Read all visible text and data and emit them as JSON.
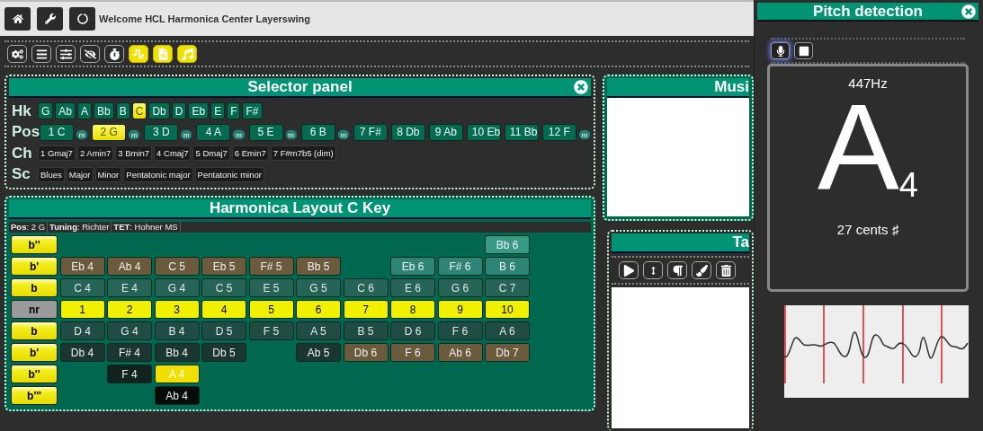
{
  "header": {
    "title": "Welcome HCL Harmonica Center Layerswing"
  },
  "toolbar": [
    {
      "active": false
    },
    {
      "active": false
    },
    {
      "active": false
    },
    {
      "active": false
    },
    {
      "active": false
    },
    {
      "active": true
    },
    {
      "active": true
    },
    {
      "active": true
    }
  ],
  "selector_panel": {
    "title": "Selector panel",
    "harmonica_keys": {
      "label": "Hk",
      "items": [
        {
          "label": "G",
          "selected": false
        },
        {
          "label": "Ab",
          "selected": false
        },
        {
          "label": "A",
          "selected": false
        },
        {
          "label": "Bb",
          "selected": false
        },
        {
          "label": "B",
          "selected": false
        },
        {
          "label": "C",
          "selected": true
        },
        {
          "label": "Db",
          "selected": false
        },
        {
          "label": "D",
          "selected": false
        },
        {
          "label": "Eb",
          "selected": false
        },
        {
          "label": "E",
          "selected": false
        },
        {
          "label": "F",
          "selected": false
        },
        {
          "label": "F#",
          "selected": false
        }
      ]
    },
    "positions": {
      "label": "Pos",
      "items": [
        {
          "label": "1 C",
          "selected": false,
          "minor": "m"
        },
        {
          "label": "2 G",
          "selected": true,
          "minor": "m"
        },
        {
          "label": "3 D",
          "selected": false,
          "minor": "m"
        },
        {
          "label": "4 A",
          "selected": false,
          "minor": "m"
        },
        {
          "label": "5 E",
          "selected": false,
          "minor": "m"
        },
        {
          "label": "6 B",
          "selected": false,
          "minor": "m"
        },
        {
          "label": "7 F#",
          "selected": false
        },
        {
          "label": "8 Db",
          "selected": false
        },
        {
          "label": "9 Ab",
          "selected": false
        },
        {
          "label": "10 Eb",
          "selected": false
        },
        {
          "label": "11 Bb",
          "selected": false
        },
        {
          "label": "12 F",
          "selected": false,
          "minor": "m"
        }
      ]
    },
    "chords": {
      "label": "Ch",
      "items": [
        "1 Gmaj7",
        "2 Amin7",
        "3 Bmin7",
        "4 Cmaj7",
        "5 Dmaj7",
        "6 Emin7",
        "7 F#m7b5 (dim)"
      ]
    },
    "scales": {
      "label": "Sc",
      "items": [
        "Blues",
        "Major",
        "Minor",
        "Pentatonic major",
        "Pentatonic minor"
      ]
    }
  },
  "layout_panel": {
    "title": "Harmonica Layout C Key",
    "info": [
      "**Pos**: 2 G",
      "**Tuning**: Richter",
      "**TET**: Hohner MS"
    ],
    "rows": [
      {
        "label": "b''",
        "kind": "bend",
        "cells": [
          {
            "kind": "empty"
          },
          {
            "kind": "empty"
          },
          {
            "kind": "empty"
          },
          {
            "kind": "empty"
          },
          {
            "kind": "empty"
          },
          {
            "kind": "empty"
          },
          {
            "kind": "empty"
          },
          {
            "kind": "empty"
          },
          {
            "kind": "empty"
          },
          {
            "note": "Bb 6",
            "kind": "blow_bend2"
          }
        ]
      },
      {
        "label": "b'",
        "kind": "bend",
        "cells": [
          {
            "note": "Eb 4",
            "kind": "overblow"
          },
          {
            "note": "Ab 4",
            "kind": "overblow"
          },
          {
            "note": "C 5",
            "kind": "overblow"
          },
          {
            "note": "Eb 5",
            "kind": "overblow"
          },
          {
            "note": "F# 5",
            "kind": "overblow"
          },
          {
            "note": "Bb 5",
            "kind": "overblow"
          },
          {
            "kind": "empty"
          },
          {
            "note": "Eb 6",
            "kind": "blow_bend"
          },
          {
            "note": "F# 6",
            "kind": "blow_bend"
          },
          {
            "note": "B 6",
            "kind": "blow_bend"
          }
        ]
      },
      {
        "label": "b",
        "kind": "bend",
        "cells": [
          {
            "note": "C 4",
            "kind": "blow"
          },
          {
            "note": "E 4",
            "kind": "blow"
          },
          {
            "note": "G 4",
            "kind": "blow"
          },
          {
            "note": "C 5",
            "kind": "blow"
          },
          {
            "note": "E 5",
            "kind": "blow"
          },
          {
            "note": "G 5",
            "kind": "blow"
          },
          {
            "note": "C 6",
            "kind": "blow"
          },
          {
            "note": "E 6",
            "kind": "blow"
          },
          {
            "note": "G 6",
            "kind": "blow"
          },
          {
            "note": "C 7",
            "kind": "blow"
          }
        ]
      },
      {
        "label": "nr",
        "kind": "hole_number",
        "cells": [
          {
            "note": "1",
            "kind": "hole"
          },
          {
            "note": "2",
            "kind": "hole"
          },
          {
            "note": "3",
            "kind": "hole"
          },
          {
            "note": "4",
            "kind": "hole"
          },
          {
            "note": "5",
            "kind": "hole"
          },
          {
            "note": "6",
            "kind": "hole"
          },
          {
            "note": "7",
            "kind": "hole"
          },
          {
            "note": "8",
            "kind": "hole"
          },
          {
            "note": "9",
            "kind": "hole"
          },
          {
            "note": "10",
            "kind": "hole"
          }
        ]
      },
      {
        "label": "b",
        "kind": "bend",
        "cells": [
          {
            "note": "D 4",
            "kind": "draw"
          },
          {
            "note": "G 4",
            "kind": "draw"
          },
          {
            "note": "B 4",
            "kind": "draw"
          },
          {
            "note": "D 5",
            "kind": "draw"
          },
          {
            "note": "F 5",
            "kind": "draw"
          },
          {
            "note": "A 5",
            "kind": "draw"
          },
          {
            "note": "B 5",
            "kind": "draw"
          },
          {
            "note": "D 6",
            "kind": "draw"
          },
          {
            "note": "F 6",
            "kind": "draw"
          },
          {
            "note": "A 6",
            "kind": "draw"
          }
        ]
      },
      {
        "label": "b'",
        "kind": "bend",
        "cells": [
          {
            "note": "Db 4",
            "kind": "draw_bend"
          },
          {
            "note": "F# 4",
            "kind": "draw_bend"
          },
          {
            "note": "Bb 4",
            "kind": "draw_bend"
          },
          {
            "note": "Db 5",
            "kind": "draw_bend"
          },
          {
            "kind": "empty"
          },
          {
            "note": "Ab 5",
            "kind": "draw_bend"
          },
          {
            "note": "Db 6",
            "kind": "overblow"
          },
          {
            "note": "F 6",
            "kind": "overblow"
          },
          {
            "note": "Ab 6",
            "kind": "overblow"
          },
          {
            "note": "Db 7",
            "kind": "overblow"
          }
        ]
      },
      {
        "label": "b''",
        "kind": "bend",
        "cells": [
          {
            "kind": "empty"
          },
          {
            "note": "F 4",
            "kind": "draw_bend2"
          },
          {
            "note": "A 4",
            "kind": "active"
          },
          {
            "kind": "empty"
          },
          {
            "kind": "empty"
          },
          {
            "kind": "empty"
          },
          {
            "kind": "empty"
          },
          {
            "kind": "empty"
          },
          {
            "kind": "empty"
          },
          {
            "kind": "empty"
          }
        ]
      },
      {
        "label": "b'''",
        "kind": "bend",
        "cells": [
          {
            "kind": "empty"
          },
          {
            "kind": "empty"
          },
          {
            "note": "Ab 4",
            "kind": "draw_bend3"
          },
          {
            "kind": "empty"
          },
          {
            "kind": "empty"
          },
          {
            "kind": "empty"
          },
          {
            "kind": "empty"
          },
          {
            "kind": "empty"
          },
          {
            "kind": "empty"
          },
          {
            "kind": "empty"
          }
        ]
      }
    ]
  },
  "music_panel": {
    "title": "Musi"
  },
  "tab_panel": {
    "title": "Ta"
  },
  "pitch_panel": {
    "title": "Pitch detection",
    "mic_focused": true,
    "frequency": "447Hz",
    "note": "A",
    "octave": "4",
    "cents": "27 cents ♯"
  }
}
